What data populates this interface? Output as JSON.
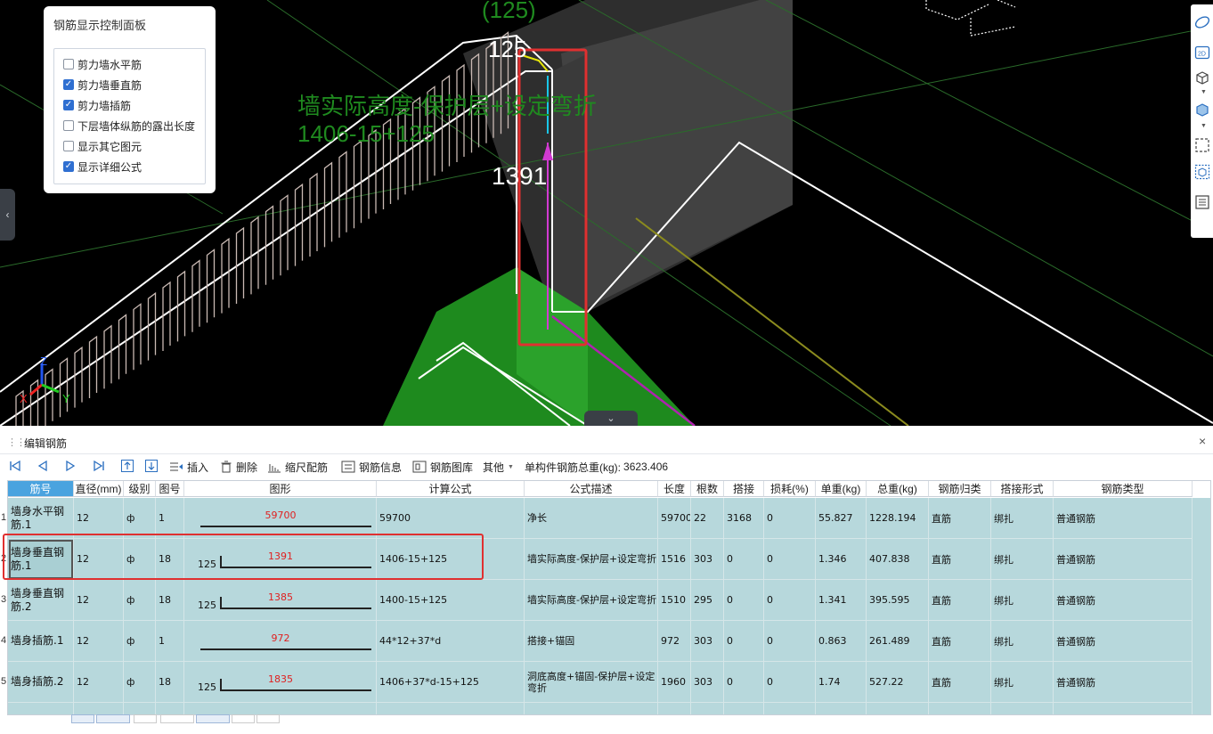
{
  "viewport": {
    "label_top": "(125)",
    "label_125": "125",
    "formula_text": "墙实际高度-保护层+设定弯折",
    "formula_calc": "1406-15+125",
    "dim_1391": "1391",
    "axis_x": "X",
    "axis_y": "Y",
    "axis_z": "Z"
  },
  "control_panel": {
    "title": "钢筋显示控制面板",
    "options": [
      {
        "label": "剪力墙水平筋",
        "checked": false
      },
      {
        "label": "剪力墙垂直筋",
        "checked": true
      },
      {
        "label": "剪力墙插筋",
        "checked": true
      },
      {
        "label": "下层墙体纵筋的露出长度",
        "checked": false
      },
      {
        "label": "显示其它图元",
        "checked": false
      },
      {
        "label": "显示详细公式",
        "checked": true
      }
    ]
  },
  "panel": {
    "title": "编辑钢筋",
    "close": "×"
  },
  "toolbar": {
    "insert": "插入",
    "delete": "删除",
    "scale": "缩尺配筋",
    "info": "钢筋信息",
    "library": "钢筋图库",
    "other": "其他",
    "total_label": "单构件钢筋总重(kg):",
    "total_value": "3623.406"
  },
  "table": {
    "headers": [
      "筋号",
      "直径(mm)",
      "级别",
      "图号",
      "图形",
      "计算公式",
      "公式描述",
      "长度",
      "根数",
      "搭接",
      "损耗(%)",
      "单重(kg)",
      "总重(kg)",
      "钢筋归类",
      "搭接形式",
      "钢筋类型"
    ],
    "rows": [
      {
        "num": "1",
        "name": "墙身水平钢筋.1",
        "dia": "12",
        "grade": "ф",
        "fig": "1",
        "lead": "",
        "shape_val": "59700",
        "bend": false,
        "formula": "59700",
        "desc": "净长",
        "length": "59700",
        "count": "22",
        "lap": "3168",
        "loss": "0",
        "unit": "55.827",
        "total": "1228.194",
        "cls": "直筋",
        "lap_type": "绑扎",
        "type": "普通钢筋"
      },
      {
        "num": "2",
        "name": "墙身垂直钢筋.1",
        "dia": "12",
        "grade": "ф",
        "fig": "18",
        "lead": "125",
        "shape_val": "1391",
        "bend": true,
        "formula": "1406-15+125",
        "desc": "墙实际高度-保护层+设定弯折",
        "length": "1516",
        "count": "303",
        "lap": "0",
        "loss": "0",
        "unit": "1.346",
        "total": "407.838",
        "cls": "直筋",
        "lap_type": "绑扎",
        "type": "普通钢筋"
      },
      {
        "num": "3",
        "name": "墙身垂直钢筋.2",
        "dia": "12",
        "grade": "ф",
        "fig": "18",
        "lead": "125",
        "shape_val": "1385",
        "bend": true,
        "formula": "1400-15+125",
        "desc": "墙实际高度-保护层+设定弯折",
        "length": "1510",
        "count": "295",
        "lap": "0",
        "loss": "0",
        "unit": "1.341",
        "total": "395.595",
        "cls": "直筋",
        "lap_type": "绑扎",
        "type": "普通钢筋"
      },
      {
        "num": "4",
        "name": "墙身插筋.1",
        "dia": "12",
        "grade": "ф",
        "fig": "1",
        "lead": "",
        "shape_val": "972",
        "bend": false,
        "formula": "44*12+37*d",
        "desc": "搭接+锚固",
        "length": "972",
        "count": "303",
        "lap": "0",
        "loss": "0",
        "unit": "0.863",
        "total": "261.489",
        "cls": "直筋",
        "lap_type": "绑扎",
        "type": "普通钢筋"
      },
      {
        "num": "5",
        "name": "墙身插筋.2",
        "dia": "12",
        "grade": "ф",
        "fig": "18",
        "lead": "125",
        "shape_val": "1835",
        "bend": true,
        "formula": "1406+37*d-15+125",
        "desc": "洞底高度+锚固-保护层+设定弯折",
        "length": "1960",
        "count": "303",
        "lap": "0",
        "loss": "0",
        "unit": "1.74",
        "total": "527.22",
        "cls": "直筋",
        "lap_type": "绑扎",
        "type": "普通钢筋"
      },
      {
        "num": "",
        "name": "",
        "dia": "",
        "grade": "",
        "fig": "",
        "lead": "",
        "shape_val": "",
        "bend": false,
        "formula": "",
        "desc": "洞底高度+锚固-保护层+设",
        "length": "",
        "count": "",
        "lap": "",
        "loss": "",
        "unit": "",
        "total": "",
        "cls": "",
        "lap_type": "",
        "type": ""
      }
    ]
  },
  "colors": {
    "highlight": "#e03030",
    "row_bg": "#b7d8dc",
    "header_accent": "#4aa3df",
    "label_green": "#1f8a1f"
  }
}
